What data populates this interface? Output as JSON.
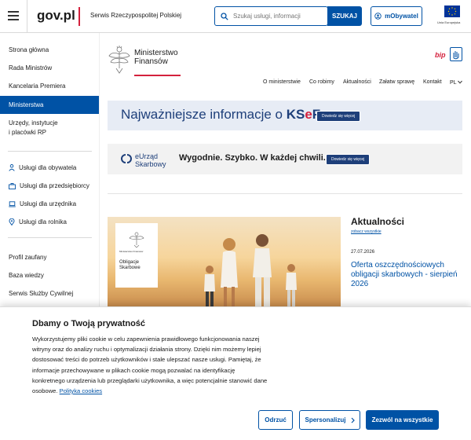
{
  "header": {
    "logo": "gov.pl",
    "service_name": "Serwis Rzeczypospolitej Polskiej",
    "search_placeholder": "Szukaj usługi, informacji",
    "search_button": "SZUKAJ",
    "mobywatel_button": "mObywatel",
    "eu_label": "Unia Europejska"
  },
  "sidebar": {
    "items": [
      "Strona główna",
      "Rada Ministrów",
      "Kancelaria Premiera",
      "Ministerstwa"
    ],
    "active_item": "Ministerstwa",
    "item_offices": [
      "Urzędy, instytucje",
      "i placówki RP"
    ],
    "services": [
      {
        "label": "Usługi dla obywatela",
        "icon": "person-icon"
      },
      {
        "label": "Usługi dla przedsiębiorcy",
        "icon": "briefcase-icon"
      },
      {
        "label": "Usługi dla urzędnika",
        "icon": "laptop-icon"
      },
      {
        "label": "Usługi dla rolnika",
        "icon": "pin-icon"
      }
    ],
    "links": [
      "Profil zaufany",
      "Baza wiedzy",
      "Serwis Służby Cywilnej"
    ]
  },
  "ministry": {
    "name_line1": "Ministerstwo",
    "name_line2": "Finansów",
    "bip": "bip",
    "nav": [
      "O ministerstwie",
      "Co robimy",
      "Aktualności",
      "Załatw sprawę",
      "Kontakt"
    ],
    "lang": "PL"
  },
  "banner1": {
    "text_pre": "Najważniejsze informacje o ",
    "text_k": "KS",
    "text_e": "e",
    "text_f": "F",
    "button": "Dowiedz się więcej"
  },
  "banner2": {
    "logo_line1": "eUrząd",
    "logo_line2": "Skarbowy",
    "slogan": "Wygodnie. Szybko. W każdej chwili.",
    "button": "Dowiedz się więcej"
  },
  "news": {
    "card_small": "Ministerstwo Finansów",
    "card_title_line1": "Obligacje",
    "card_title_line2": "Skarbowe",
    "section_title": "Aktualności",
    "see_all": "zobacz wszystkie",
    "date": "27.07.2026",
    "headline": "Oferta oszczędnościowych obligacji skarbowych - sierpień 2026"
  },
  "cookie": {
    "title": "Dbamy o Twoją prywatność",
    "body": "Wykorzystujemy pliki cookie w celu zapewnienia prawidłowego funkcjonowania naszej witryny oraz do analizy ruchu i optymalizacji działania strony. Dzięki nim możemy lepiej dostosować treści do potrzeb użytkowników i stale ulepszać nasze usługi. Pamiętaj, że informacje przechowywane w plikach cookie mogą pozwalać na identyfikację konkretnego urządzenia lub przeglądarki użytkownika, a więc potencjalnie stanowić dane osobowe.",
    "policy_link": "Polityka cookies",
    "reject": "Odrzuć",
    "personalize": "Spersonalizuj",
    "accept_all": "Zezwól na wszystkie"
  },
  "colors": {
    "primary": "#0052a5",
    "accent_red": "#d4213d",
    "navy": "#1e3f7a"
  }
}
